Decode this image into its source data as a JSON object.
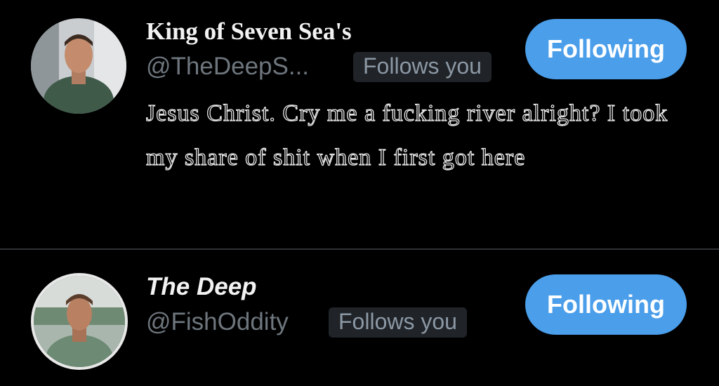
{
  "accounts": [
    {
      "display_name": "King of Seven Sea's",
      "handle": "@TheDeepS...",
      "follows_you": "Follows you",
      "button": "Following",
      "bio": "Jesus Christ. Cry me a fucking river alright? I took my share of shit when I first got here"
    },
    {
      "display_name": "The Deep",
      "handle": "@FishOddity",
      "follows_you": "Follows you",
      "button": "Following"
    }
  ],
  "colors": {
    "background": "#000000",
    "button": "#4a9eea",
    "handle": "#6e767d",
    "badge_bg": "#202327"
  }
}
